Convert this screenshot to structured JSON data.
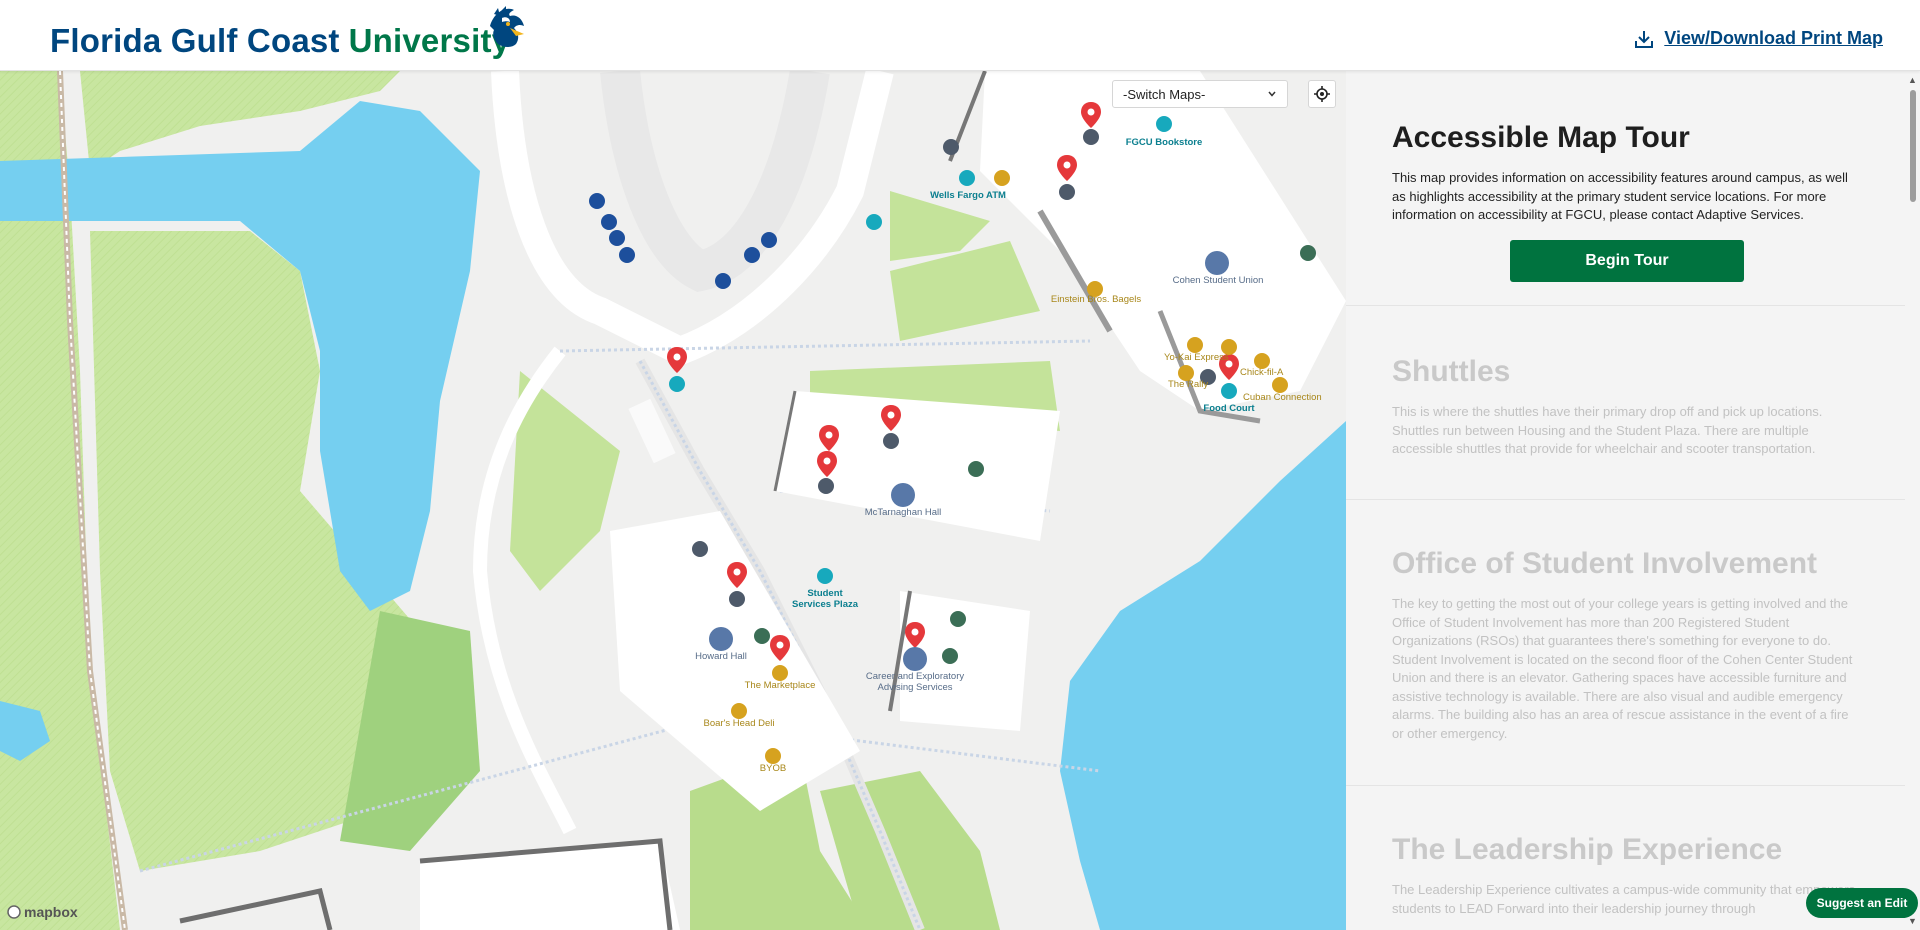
{
  "header": {
    "logo_part1": "Florida Gulf Coast",
    "logo_part2": "University",
    "print_link": "View/Download Print Map"
  },
  "map": {
    "switch_maps": "-Switch Maps-",
    "attribution": "mapbox",
    "labels": {
      "fgcu_bookstore": "FGCU Bookstore",
      "wells_fargo_atm": "Wells Fargo ATM",
      "einstein_bros": "Einstein Bros. Bagels",
      "cohen_student_union": "Cohen Student Union",
      "yo_kai": "Yo-Kai Express",
      "the_rally": "The Rally",
      "chick_fil_a": "Chick-fil-A",
      "cuban_connection": "Cuban Connection",
      "food_court": "Food Court",
      "mctarnaghan_hall": "McTarnaghan Hall",
      "student_services_plaza_1": "Student",
      "student_services_plaza_2": "Services Plaza",
      "howard_hall": "Howard Hall",
      "the_marketplace": "The Marketplace",
      "boars_head_deli": "Boar's Head Deli",
      "byob": "BYOB",
      "career_advising_1": "Career and Exploratory",
      "career_advising_2": "Advising Services"
    }
  },
  "panel": {
    "sections": [
      {
        "title": "Accessible Map Tour",
        "text": "This map provides information on accessibility features around campus, as well as highlights accessibility at the primary student service locations. For more information on accessibility at FGCU, please contact Adaptive Services.",
        "button": "Begin Tour"
      },
      {
        "title": "Shuttles",
        "text": "This is where the shuttles have their primary drop off and pick up locations. Shuttles run between Housing and the Student Plaza. There are multiple accessible shuttles that provide for wheelchair and scooter transportation."
      },
      {
        "title": "Office of Student Involvement",
        "text": "The key to getting the most out of your college years is getting involved and the Office of Student Involvement has more than 200 Registered Student Organizations (RSOs) that guarantees there's something for everyone to do. Student Involvement is located on the second floor of the Cohen Center Student Union and there is an elevator. Gathering spaces have accessible furniture and assistive technology is available. There are also visual and audible emergency alarms. The building also has an area of rescue assistance in the event of a fire or other emergency."
      },
      {
        "title": "The Leadership Experience",
        "text": "The Leadership Experience cultivates a campus-wide community that empowers students to LEAD Forward into their leadership journey through"
      }
    ],
    "suggest_edit": "Suggest an Edit"
  },
  "colors": {
    "brand_blue": "#00467f",
    "brand_green": "#007749",
    "button_green": "#00733f",
    "water": "#75cff0",
    "grass": "#c8e6a0",
    "pin_red": "#e5383b"
  }
}
